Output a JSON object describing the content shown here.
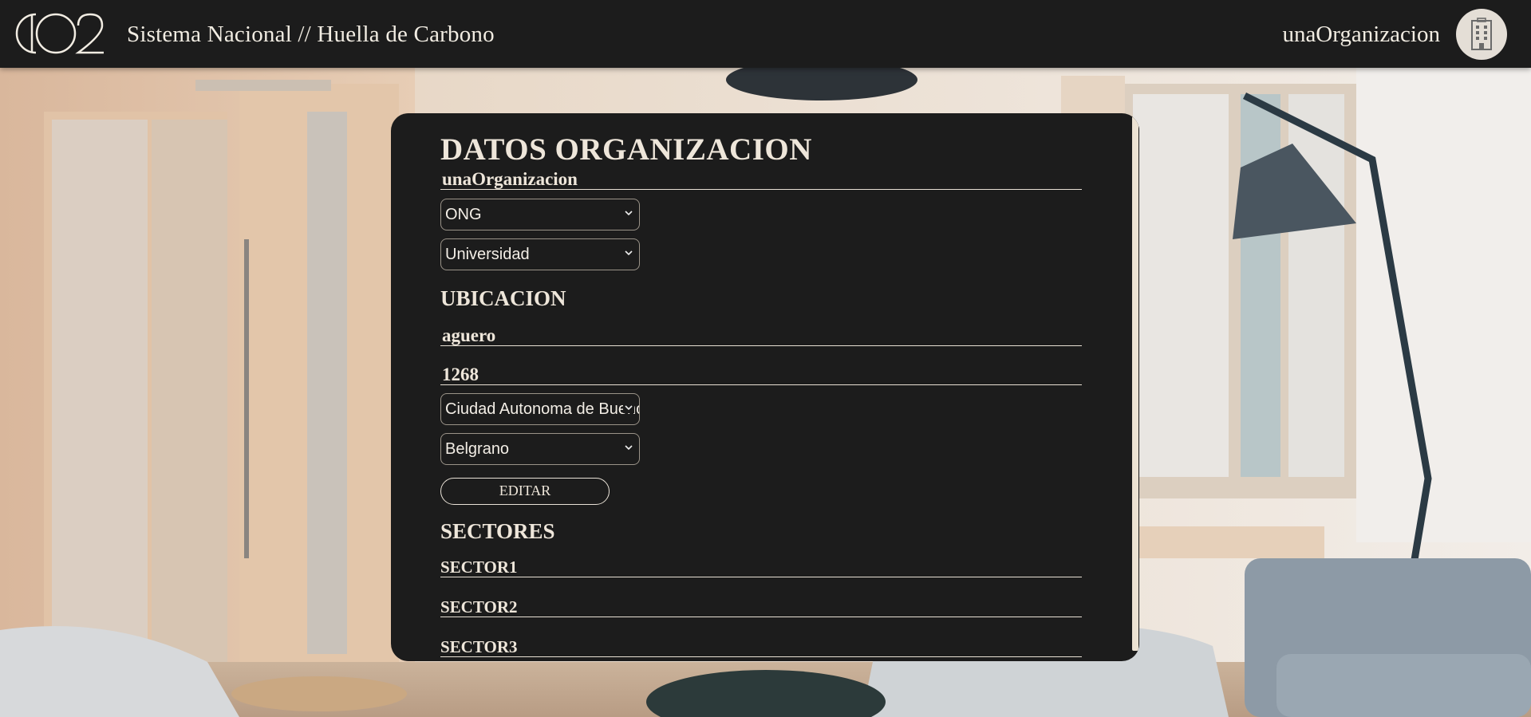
{
  "header": {
    "logo_text": "CO2",
    "app_title": "Sistema Nacional // Huella de Carbono",
    "user_name": "unaOrganizacion",
    "avatar_icon": "building-icon"
  },
  "organization": {
    "heading": "DATOS ORGANIZACION",
    "name": "unaOrganizacion",
    "type": "ONG",
    "classification": "Universidad"
  },
  "location": {
    "heading": "UBICACION",
    "street": "aguero",
    "number": "1268",
    "province": "Ciudad Autonoma de Buenos Aires",
    "locality": "Belgrano",
    "edit_label": "EDITAR"
  },
  "sectors": {
    "heading": "SECTORES",
    "items": [
      {
        "label": "SECTOR1"
      },
      {
        "label": "SECTOR2"
      },
      {
        "label": "SECTOR3"
      }
    ]
  },
  "colors": {
    "panel_bg": "#1c1c1c",
    "header_bg": "#1c1c1c",
    "text": "#eee6da",
    "accent": "#e8e0d4"
  }
}
